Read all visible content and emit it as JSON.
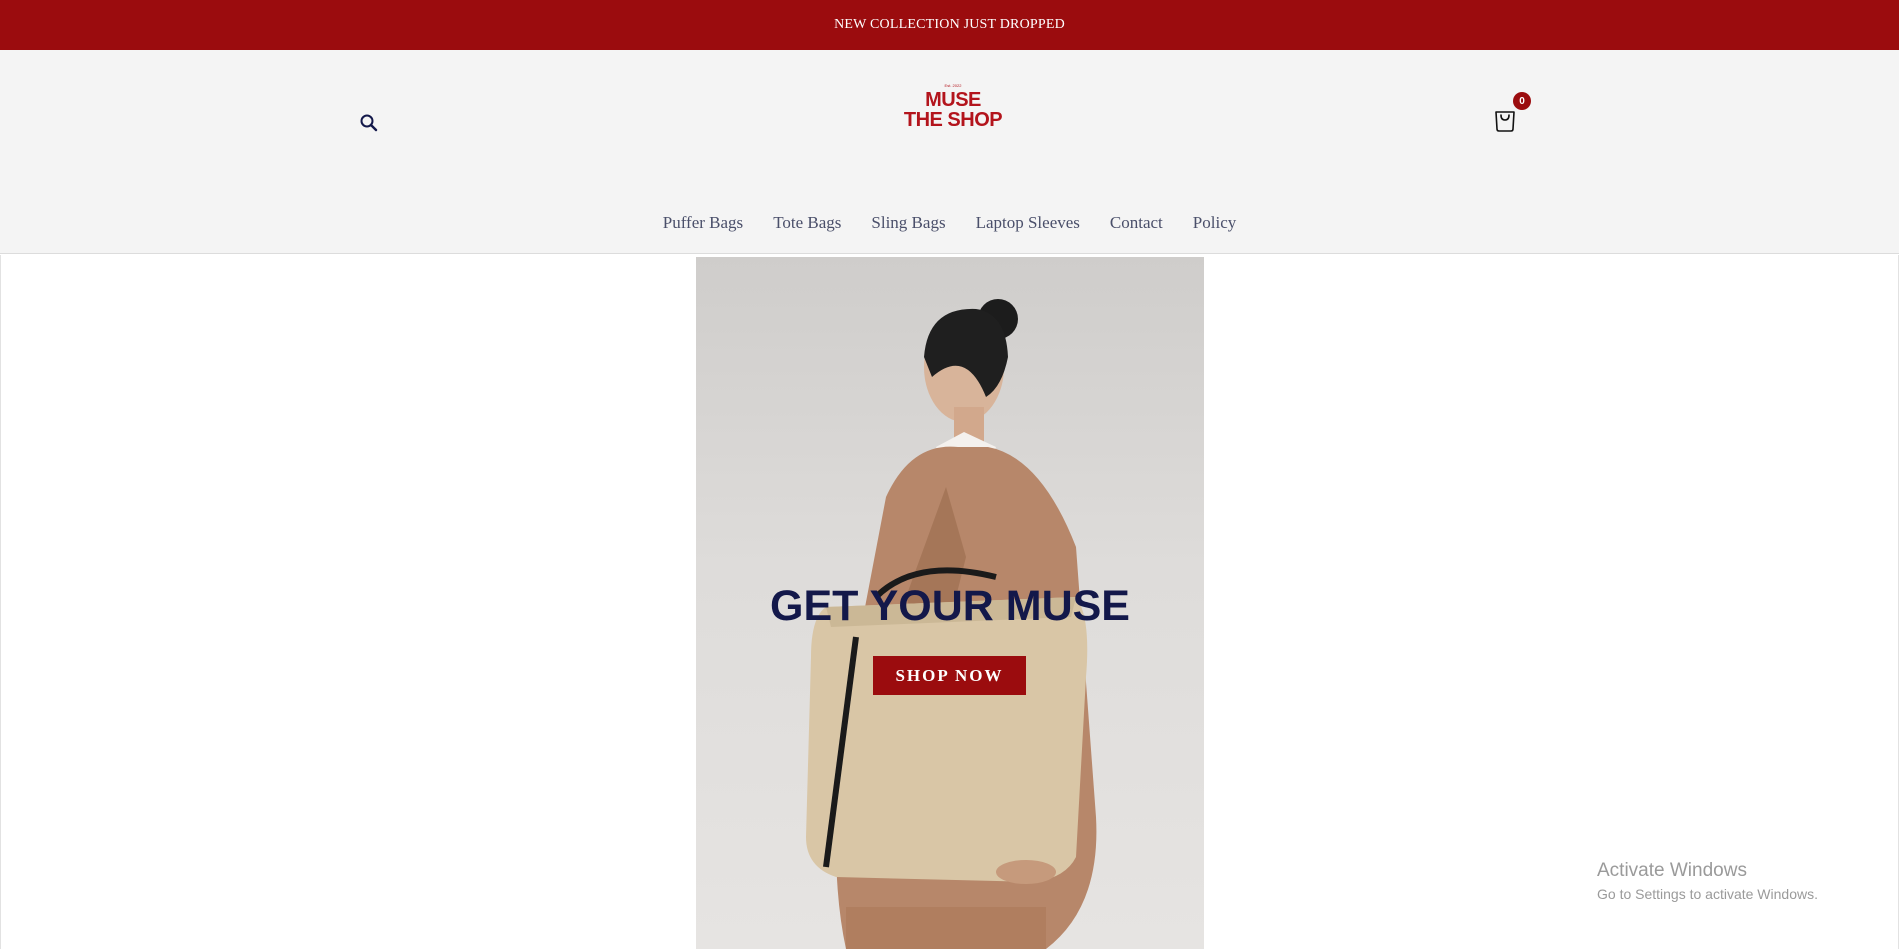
{
  "announcement": {
    "text": "NEW COLLECTION JUST DROPPED"
  },
  "header": {
    "search_icon": "search-icon",
    "logo": {
      "est": "Est. 2022",
      "line1": "MUSE",
      "line2": "THE SHOP"
    },
    "cart_icon": "shopping-bag-icon",
    "cart_count": "0"
  },
  "nav": {
    "items": [
      {
        "label": "Puffer Bags"
      },
      {
        "label": "Tote Bags"
      },
      {
        "label": "Sling Bags"
      },
      {
        "label": "Laptop Sleeves"
      },
      {
        "label": "Contact"
      },
      {
        "label": "Policy"
      }
    ]
  },
  "hero": {
    "title": "GET YOUR MUSE",
    "button_label": "SHOP NOW"
  },
  "watermark": {
    "title": "Activate Windows",
    "subtitle": "Go to Settings to activate Windows."
  },
  "colors": {
    "brand_red": "#9b0c0e",
    "logo_red": "#b3141c",
    "hero_title_navy": "#13184a",
    "nav_text": "#4a4f6a",
    "header_bg": "#f4f4f4"
  }
}
